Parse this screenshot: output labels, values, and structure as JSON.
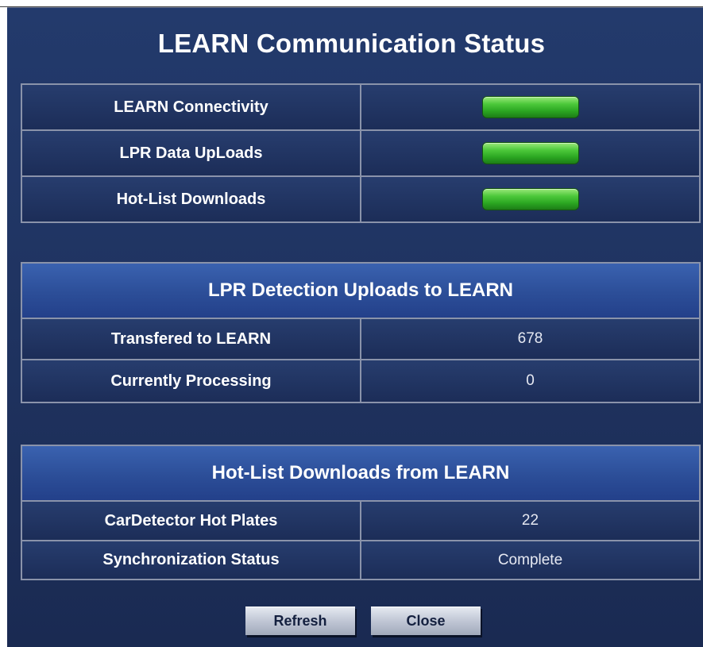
{
  "title": "LEARN Communication Status",
  "status": {
    "rows": [
      {
        "label": "LEARN Connectivity",
        "indicator": "green"
      },
      {
        "label": "LPR Data UpLoads",
        "indicator": "green"
      },
      {
        "label": "Hot-List Downloads",
        "indicator": "green"
      }
    ]
  },
  "uploads": {
    "header": "LPR Detection Uploads to LEARN",
    "rows": [
      {
        "label": "Transfered to LEARN",
        "value": "678"
      },
      {
        "label": "Currently Processing",
        "value": "0"
      }
    ]
  },
  "downloads": {
    "header": "Hot-List Downloads from LEARN",
    "rows": [
      {
        "label": "CarDetector Hot Plates",
        "value": "22"
      },
      {
        "label": "Synchronization Status",
        "value": "Complete"
      }
    ]
  },
  "buttons": {
    "refresh": "Refresh",
    "close": "Close"
  },
  "colors": {
    "background": "#1f3360",
    "header": "#2c4e98",
    "indicator_ok": "#2aa521"
  }
}
